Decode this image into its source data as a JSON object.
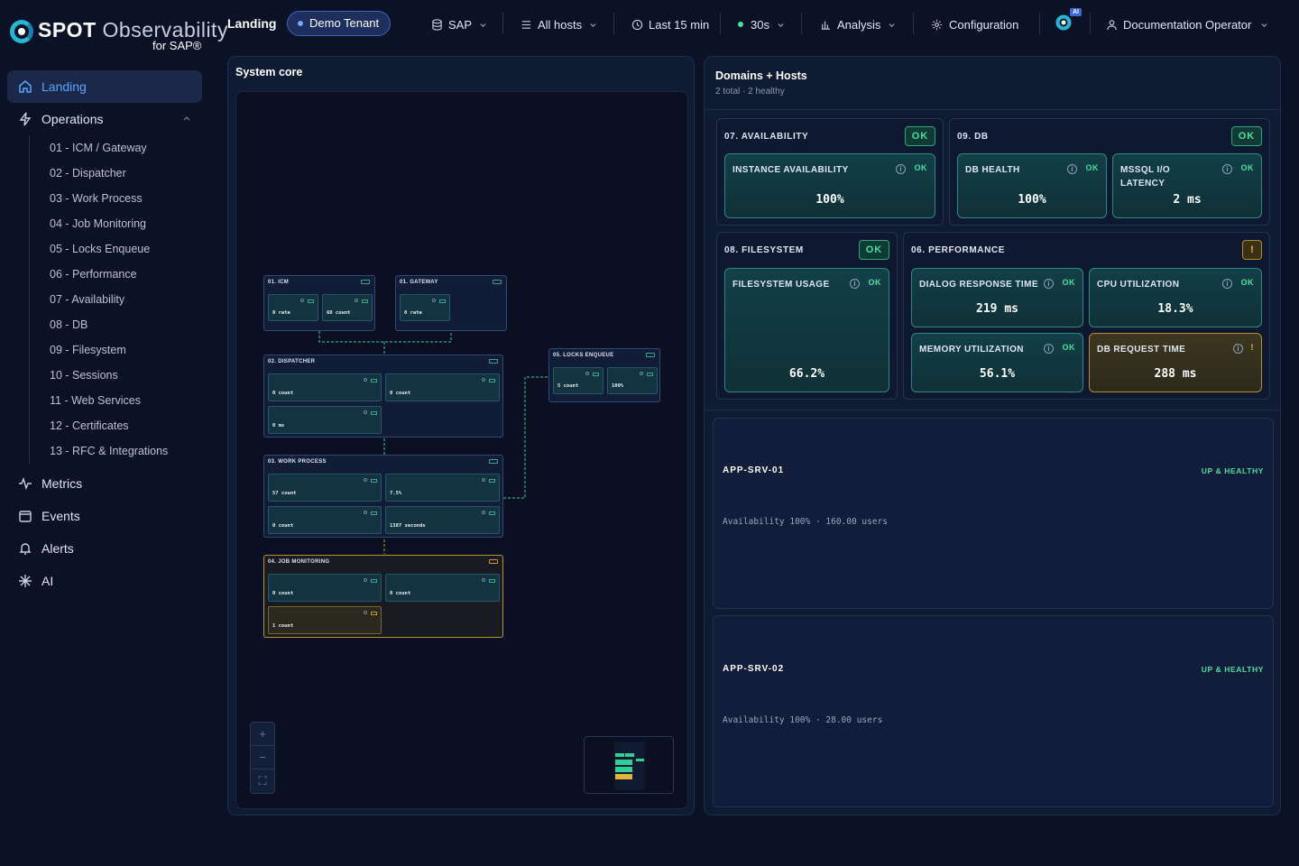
{
  "brand": {
    "name_bold": "SPOT",
    "name_thin": " Observability",
    "sub": "for SAP®"
  },
  "sidebar": {
    "items": [
      {
        "label": "Landing",
        "icon": "home-icon"
      },
      {
        "label": "Operations",
        "icon": "bolt-icon"
      },
      {
        "label": "Metrics",
        "icon": "pulse-icon"
      },
      {
        "label": "Events",
        "icon": "calendar-icon"
      },
      {
        "label": "Alerts",
        "icon": "bell-icon"
      },
      {
        "label": "AI",
        "icon": "sparkle-icon"
      }
    ],
    "operations": [
      "01 - ICM / Gateway",
      "02 - Dispatcher",
      "03 - Work Process",
      "04 - Job Monitoring",
      "05 - Locks Enqueue",
      "06 - Performance",
      "07 - Availability",
      "08 - DB",
      "09 - Filesystem",
      "10 - Sessions",
      "11 - Web Services",
      "12 - Certificates",
      "13 - RFC & Integrations"
    ]
  },
  "header": {
    "page": "Landing",
    "tenant": "Demo Tenant",
    "system": "SAP",
    "hosts": "All hosts",
    "time": "Last 15 min",
    "refresh": "30s",
    "analysis": "Analysis",
    "config": "Configuration",
    "ai_badge": "AI",
    "user": "Documentation Operator"
  },
  "core": {
    "title": "System core",
    "nodes": {
      "icm": {
        "title": "01. ICM",
        "m1v": "0 rate",
        "m2v": "60 count"
      },
      "gateway": {
        "title": "01. GATEWAY",
        "m1v": "0 rate"
      },
      "locks": {
        "title": "05. LOCKS ENQUEUE",
        "m1v": "5 count",
        "m2v": "100%"
      },
      "dispatcher": {
        "title": "02. DISPATCHER",
        "m1v": "0 count",
        "m2v": "0 count",
        "m3v": "0 ms"
      },
      "workprocess": {
        "title": "03. WORK PROCESS",
        "m1v": "57 count",
        "m2v": "7.5%",
        "m3v": "0 count",
        "m4v": "1387 seconds"
      },
      "jobs": {
        "title": "04. JOB MONITORING",
        "m1v": "0 count",
        "m2v": "0 count",
        "m3v": "1 count"
      }
    }
  },
  "domains": {
    "title": "Domains + Hosts",
    "subtitle": "2 total · 2 healthy",
    "availability": {
      "title": "07. AVAILABILITY",
      "badge": "OK",
      "m1": {
        "label": "INSTANCE AVAILABILITY",
        "status": "OK",
        "value": "100%"
      }
    },
    "db": {
      "title": "09. DB",
      "badge": "OK",
      "m1": {
        "label": "DB HEALTH",
        "status": "OK",
        "value": "100%"
      },
      "m2": {
        "label": "MSSQL I/O LATENCY",
        "status": "OK",
        "value": "2 ms"
      }
    },
    "filesystem": {
      "title": "08. FILESYSTEM",
      "badge": "OK",
      "m1": {
        "label": "FILESYSTEM USAGE",
        "status": "OK",
        "value": "66.2%"
      }
    },
    "performance": {
      "title": "06. PERFORMANCE",
      "badge": "!",
      "m1": {
        "label": "DIALOG RESPONSE TIME",
        "status": "OK",
        "value": "219 ms"
      },
      "m2": {
        "label": "CPU UTILIZATION",
        "status": "OK",
        "value": "18.3%"
      },
      "m3": {
        "label": "MEMORY UTILIZATION",
        "status": "OK",
        "value": "56.1%"
      },
      "m4": {
        "label": "DB REQUEST TIME",
        "status": "!",
        "value": "288 ms"
      }
    },
    "hosts": [
      {
        "name": "APP-SRV-01",
        "status": "UP & HEALTHY",
        "info": "Availability 100% · 160.00 users"
      },
      {
        "name": "APP-SRV-02",
        "status": "UP & HEALTHY",
        "info": "Availability 100% · 28.00 users"
      }
    ]
  },
  "colors": {
    "accent": "#58a6ff",
    "ok": "#46e0a0",
    "warn": "#f0b93a",
    "background": "#0b1226"
  }
}
